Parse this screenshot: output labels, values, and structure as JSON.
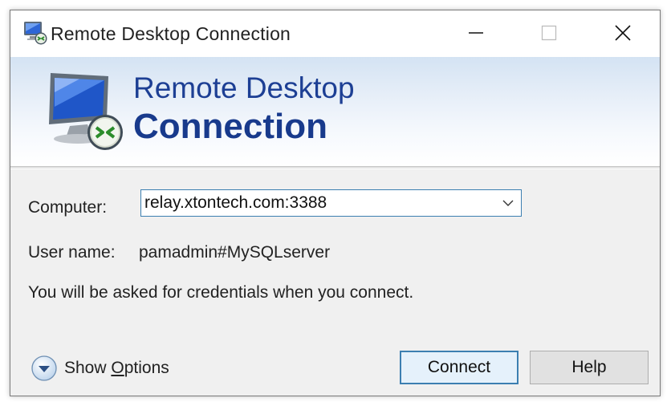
{
  "window": {
    "title": "Remote Desktop Connection",
    "icon": "remote-desktop-icon"
  },
  "banner": {
    "line1": "Remote Desktop",
    "line2": "Connection",
    "icon": "remote-desktop-monitor-icon"
  },
  "form": {
    "computer_label": "Computer:",
    "computer_value": "relay.xtontech.com:3388",
    "user_label": "User name:",
    "user_value": "pamadmin#MySQLserver",
    "info_text": "You will be asked for credentials when you connect."
  },
  "footer": {
    "show_options_prefix": "Show ",
    "show_options_underlined": "O",
    "show_options_suffix": "ptions",
    "connect_label": "Connect",
    "help_label": "Help"
  },
  "colors": {
    "accent_blue": "#1d3f94",
    "focus_border": "#3c7fb1"
  }
}
